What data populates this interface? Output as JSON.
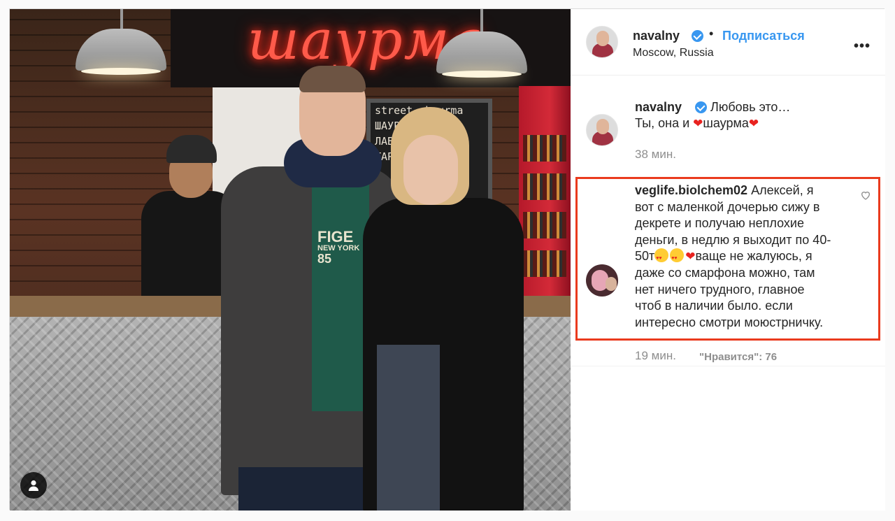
{
  "post": {
    "photo": {
      "neon_sign": "шаурма",
      "menu_board": [
        "street shaurma",
        "ШАУРМА 250р",
        "ЛАВАШ 200р",
        "ТАРЕЛКА 250р"
      ],
      "hoodie_logo": [
        "FIGE",
        "NEW YORK",
        "85"
      ],
      "tag_button_icon": "user-icon"
    },
    "header": {
      "username": "navalny",
      "dot": "•",
      "follow_label": "Подписаться",
      "location": "Moscow, Russia",
      "more_label": "•••"
    },
    "caption": {
      "username": "navalny",
      "line1": "Любовь это…",
      "line2_prefix": "Ты, она и ",
      "line2_word": "шаурма",
      "time": "38 мин."
    },
    "comment": {
      "username": "veglife.biolchem02",
      "text_lines": [
        "Алексей, я",
        "вот с маленкой дочерью сижу в",
        "декрете и получаю неплохие",
        "деньги, в недлю я выходит по 40-",
        "50т",
        "ваще не жалуюсь, я",
        "даже со смарфона можно, там",
        "нет ничего трудного, главное",
        "чтоб в наличии было. если",
        "интересно смотри моюстрничку."
      ],
      "time": "19 мин.",
      "likes": "\"Нравится\": 76"
    },
    "colors": {
      "link_blue": "#3897f0",
      "highlight_red": "#ea3b1e",
      "heart_red": "#e8221f",
      "muted_gray": "#8e8e8e"
    }
  }
}
